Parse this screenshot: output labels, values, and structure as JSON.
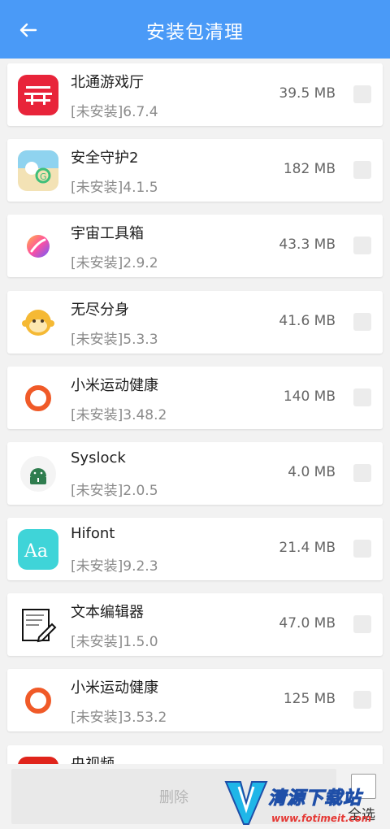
{
  "header": {
    "title": "安装包清理",
    "back_icon": "arrow-left-icon"
  },
  "apps": [
    {
      "name": "北通游戏厅",
      "version": "[未安装]6.7.4",
      "size": "39.5 MB",
      "icon": "betop-logo-icon"
    },
    {
      "name": "安全守护2",
      "version": "[未安装]4.1.5",
      "size": "182 MB",
      "icon": "beach-cartoon-icon"
    },
    {
      "name": "宇宙工具箱",
      "version": "[未安装]2.9.2",
      "size": "43.3 MB",
      "icon": "gradient-circle-icon"
    },
    {
      "name": "无尽分身",
      "version": "[未安装]5.3.3",
      "size": "41.6 MB",
      "icon": "monkey-face-icon"
    },
    {
      "name": "小米运动健康",
      "version": "[未安装]3.48.2",
      "size": "140 MB",
      "icon": "orange-ring-icon"
    },
    {
      "name": "Syslock",
      "version": "[未安装]2.0.5",
      "size": "4.0 MB",
      "icon": "android-lock-icon"
    },
    {
      "name": "Hifont",
      "version": "[未安装]9.2.3",
      "size": "21.4 MB",
      "icon": "font-aa-icon"
    },
    {
      "name": "文本编辑器",
      "version": "[未安装]1.5.0",
      "size": "47.0 MB",
      "icon": "note-pencil-icon"
    },
    {
      "name": "小米运动健康",
      "version": "[未安装]3.53.2",
      "size": "125 MB",
      "icon": "orange-ring-icon"
    },
    {
      "name": "央视频",
      "version": "",
      "size": "",
      "icon": "red-app-icon"
    }
  ],
  "footer": {
    "delete_label": "删除",
    "select_all_label": "全选"
  },
  "watermark": {
    "text": "清源下载站",
    "url": "www.fotimeit.com"
  },
  "colors": {
    "header_bg": "#4a9af7",
    "card_bg": "#ffffff",
    "page_bg": "#f2f2f2"
  }
}
